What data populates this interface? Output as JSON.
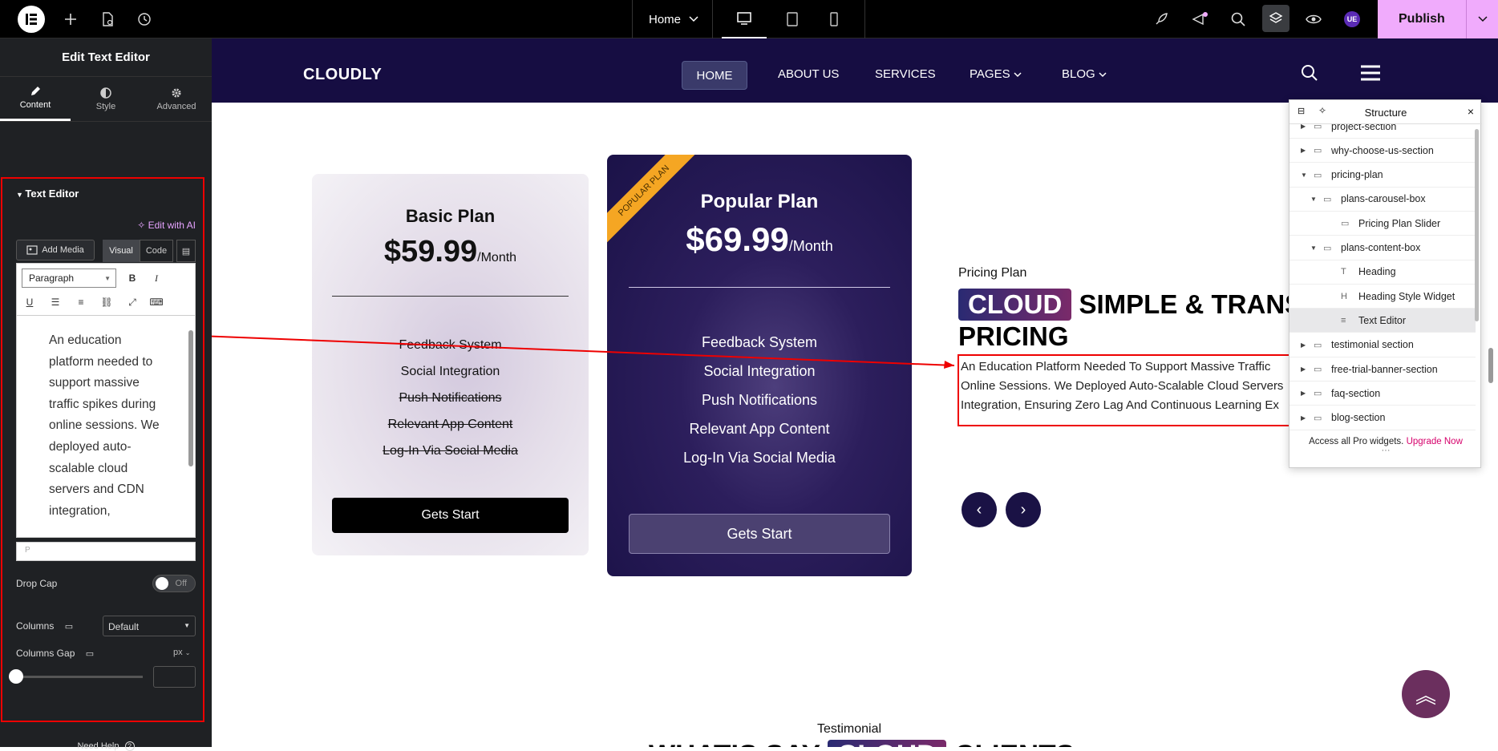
{
  "topbar": {
    "page_select": "Home",
    "publish_label": "Publish",
    "avatar_initials": "UE"
  },
  "left_panel": {
    "title": "Edit Text Editor",
    "tabs": [
      {
        "label": "Content",
        "icon": "pencil-icon",
        "active": true
      },
      {
        "label": "Style",
        "icon": "contrast-icon",
        "active": false
      },
      {
        "label": "Advanced",
        "icon": "gear-icon",
        "active": false
      }
    ],
    "section_title": "Text Editor",
    "edit_with_ai": "Edit with AI",
    "add_media": "Add Media",
    "visual_tab": "Visual",
    "code_tab": "Code",
    "format_select": "Paragraph",
    "editor_text": "An education platform needed to support massive traffic spikes during online sessions. We deployed auto-scalable cloud servers and CDN integration,",
    "path_indicator": "P",
    "drop_cap_label": "Drop Cap",
    "drop_cap_state": "Off",
    "columns_label": "Columns",
    "columns_value": "Default",
    "columns_gap_label": "Columns Gap",
    "columns_gap_unit": "px",
    "need_help": "Need Help"
  },
  "site": {
    "brand": "CLOUDLY",
    "nav": [
      "HOME",
      "ABOUT US",
      "SERVICES",
      "PAGES",
      "BLOG"
    ],
    "basic_plan": {
      "name": "Basic Plan",
      "price": "$59.99",
      "period": "/Month",
      "features": [
        {
          "text": "Feedback System",
          "struck": false
        },
        {
          "text": "Social Integration",
          "struck": false
        },
        {
          "text": "Push Notifications",
          "struck": true
        },
        {
          "text": "Relevant App Content",
          "struck": true
        },
        {
          "text": "Log-In Via Social Media",
          "struck": true
        }
      ],
      "button": "Gets Start"
    },
    "popular_plan": {
      "ribbon": "POPULAR PLAN",
      "name": "Popular Plan",
      "price": "$69.99",
      "period": "/Month",
      "features": [
        "Feedback System",
        "Social Integration",
        "Push Notifications",
        "Relevant App Content",
        "Log-In Via Social Media"
      ],
      "button": "Gets Start"
    },
    "pricing_label": "Pricing Plan",
    "heading_badge": "CLOUD",
    "heading_rest_line1": "SIMPLE & TRANSP",
    "heading_line2": "PRICING",
    "paragraph_lines": [
      "An Education Platform Needed To Support Massive Traffic",
      "Online Sessions. We Deployed Auto-Scalable Cloud Servers",
      "Integration, Ensuring Zero Lag And Continuous Learning Ex"
    ],
    "testimonial_label": "Testimonial",
    "testimonial_heading_pre": "WHAT’S SAY",
    "testimonial_heading_badge": "CLOUD",
    "testimonial_heading_post": "CLIENTS"
  },
  "structure": {
    "title": "Structure",
    "items": [
      {
        "label": "project-section",
        "depth": 0,
        "toggle": "collapsed",
        "icon": "section-icon"
      },
      {
        "label": "why-choose-us-section",
        "depth": 0,
        "toggle": "collapsed",
        "icon": "section-icon"
      },
      {
        "label": "pricing-plan",
        "depth": 0,
        "toggle": "expanded",
        "icon": "section-icon"
      },
      {
        "label": "plans-carousel-box",
        "depth": 1,
        "toggle": "expanded",
        "icon": "section-icon"
      },
      {
        "label": "Pricing Plan Slider",
        "depth": 2,
        "toggle": "none",
        "icon": "slider-icon"
      },
      {
        "label": "plans-content-box",
        "depth": 1,
        "toggle": "expanded",
        "icon": "section-icon"
      },
      {
        "label": "Heading",
        "depth": 2,
        "toggle": "none",
        "icon": "heading-icon"
      },
      {
        "label": "Heading Style Widget",
        "depth": 2,
        "toggle": "none",
        "icon": "heading-style-icon"
      },
      {
        "label": "Text Editor",
        "depth": 2,
        "toggle": "none",
        "icon": "text-editor-icon",
        "active": true
      },
      {
        "label": "testimonial section",
        "depth": 0,
        "toggle": "collapsed",
        "icon": "section-icon"
      },
      {
        "label": "free-trial-banner-section",
        "depth": 0,
        "toggle": "collapsed",
        "icon": "section-icon"
      },
      {
        "label": "faq-section",
        "depth": 0,
        "toggle": "collapsed",
        "icon": "section-icon"
      },
      {
        "label": "blog-section",
        "depth": 0,
        "toggle": "collapsed",
        "icon": "section-icon"
      }
    ],
    "footer_text": "Access all Pro widgets.",
    "footer_link": "Upgrade Now"
  },
  "colors": {
    "nav_bg": "#160d42",
    "publish_bg": "#f0abfc",
    "highlight_red": "#e00000",
    "ai_accent": "#e6a3ff",
    "upgrade_link": "#d6006b"
  }
}
